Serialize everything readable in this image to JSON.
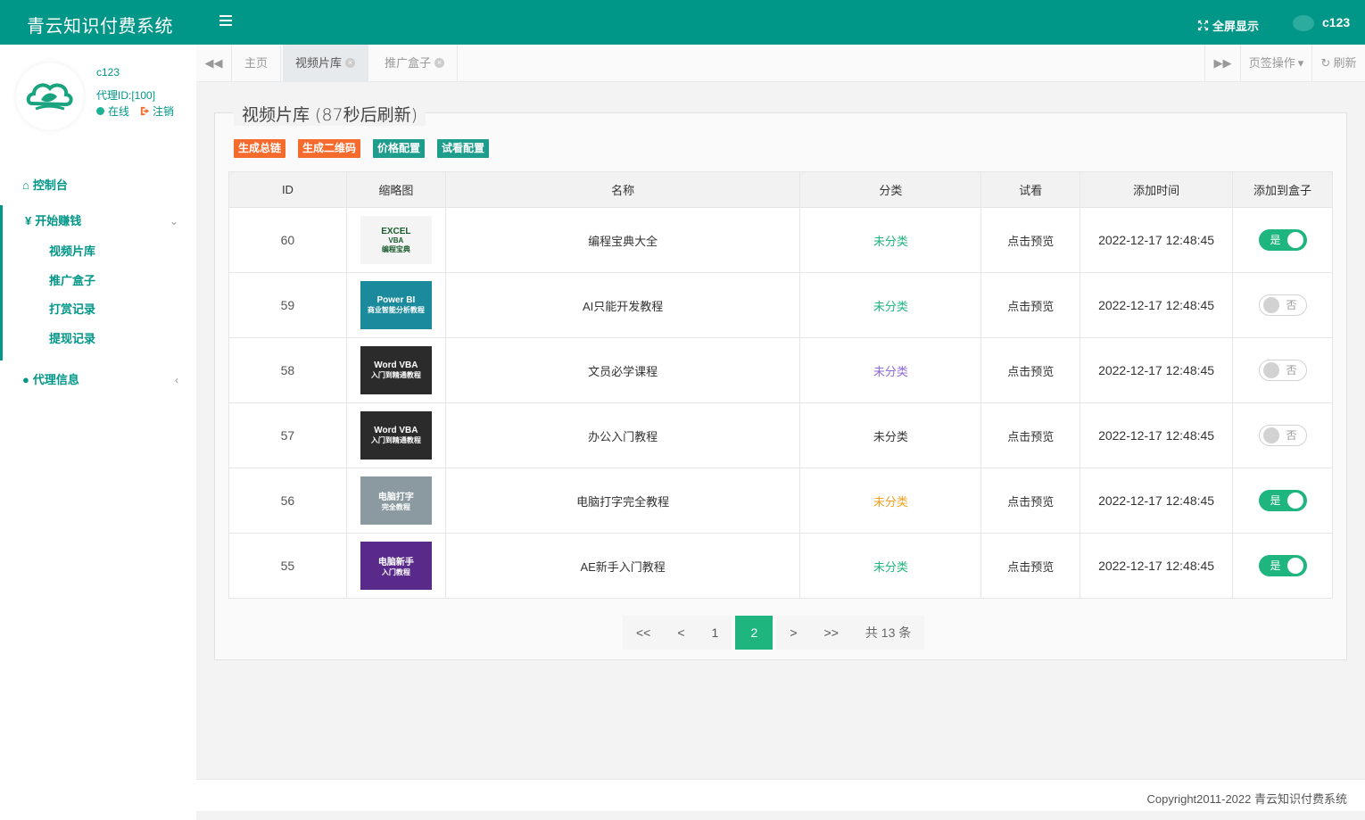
{
  "header": {
    "brand": "青云知识付费系统",
    "fullscreen_label": "全屏显示",
    "username": "c123"
  },
  "sidebar": {
    "profile": {
      "name": "c123",
      "agent_id": "代理ID:[100]",
      "status": "在线",
      "logout": "注销"
    },
    "dashboard": "控制台",
    "earn_group": {
      "label": "开始赚钱",
      "items": [
        "视频片库",
        "推广盒子",
        "打赏记录",
        "提现记录"
      ]
    },
    "agent_info": "代理信息"
  },
  "tabbar": {
    "tabs": [
      "主页",
      "视频片库",
      "推广盒子"
    ],
    "page_ops": "页签操作",
    "refresh": "刷新"
  },
  "main": {
    "title": "视频片库 (87秒后刷新)",
    "actions": [
      "生成总链",
      "生成二维码",
      "价格配置",
      "试看配置"
    ],
    "columns": [
      "ID",
      "缩略图",
      "名称",
      "分类",
      "试看",
      "添加时间",
      "添加到盒子"
    ],
    "rows": [
      {
        "id": "60",
        "thumb": [
          "EXCEL",
          "VBA",
          "编程宝典"
        ],
        "thumb_bg": "#f4f4f4",
        "thumb_fg": "#1a5c2e",
        "name": "编程宝典大全",
        "category": "未分类",
        "cat_color": "#1fb57f",
        "preview": "点击预览",
        "time": "2022-12-17 12:48:45",
        "in_box": true
      },
      {
        "id": "59",
        "thumb": [
          "Power BI",
          "商业智能分析教程",
          ""
        ],
        "thumb_bg": "#1b8a9c",
        "thumb_fg": "#ffffff",
        "name": "AI只能开发教程",
        "category": "未分类",
        "cat_color": "#1fb57f",
        "preview": "点击预览",
        "time": "2022-12-17 12:48:45",
        "in_box": false
      },
      {
        "id": "58",
        "thumb": [
          "Word VBA",
          "入门到精通教程",
          ""
        ],
        "thumb_bg": "#2b2b2b",
        "thumb_fg": "#ffffff",
        "name": "文员必学课程",
        "category": "未分类",
        "cat_color": "#8b6bd9",
        "preview": "点击预览",
        "time": "2022-12-17 12:48:45",
        "in_box": false
      },
      {
        "id": "57",
        "thumb": [
          "Word VBA",
          "入门到精通教程",
          ""
        ],
        "thumb_bg": "#2b2b2b",
        "thumb_fg": "#ffffff",
        "name": "办公入门教程",
        "category": "未分类",
        "cat_color": "#333333",
        "preview": "点击预览",
        "time": "2022-12-17 12:48:45",
        "in_box": false
      },
      {
        "id": "56",
        "thumb": [
          "电脑打字",
          "完全教程",
          ""
        ],
        "thumb_bg": "#8a9aa0",
        "thumb_fg": "#ffffff",
        "name": "电脑打字完全教程",
        "category": "未分类",
        "cat_color": "#f0a020",
        "preview": "点击预览",
        "time": "2022-12-17 12:48:45",
        "in_box": true
      },
      {
        "id": "55",
        "thumb": [
          "电脑新手",
          "入门教程",
          ""
        ],
        "thumb_bg": "#5a2a8a",
        "thumb_fg": "#ffffff",
        "name": "AE新手入门教程",
        "category": "未分类",
        "cat_color": "#1fb57f",
        "preview": "点击预览",
        "time": "2022-12-17 12:48:45",
        "in_box": true
      }
    ],
    "switch_on": "是",
    "switch_off": "否"
  },
  "pagination": {
    "first": "<<",
    "prev": "<",
    "pages": [
      "1",
      "2"
    ],
    "current": "2",
    "next": ">",
    "last": ">>",
    "total": "共 13 条"
  },
  "footer": {
    "copyright": "Copyright2011-2022 青云知识付费系统"
  },
  "colors": {
    "brand": "#009688",
    "accent_green": "#1fb57f",
    "orange": "#f56a2d"
  }
}
